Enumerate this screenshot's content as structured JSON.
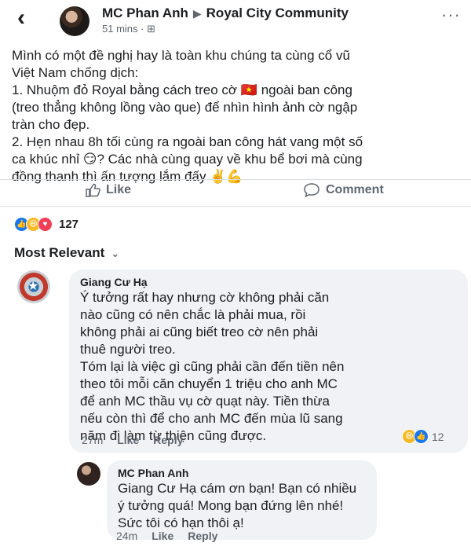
{
  "header": {
    "back_icon": "chevron-left-icon",
    "author": "MC Phan Anh",
    "separator": "▶",
    "group": "Royal City Community",
    "time": "51 mins",
    "privacy_icon": "group-icon",
    "more": "···"
  },
  "post": {
    "lines": [
      "Mình có một đề nghị hay là toàn khu chúng ta cùng cổ vũ",
      "Việt Nam chống dịch:",
      "1. Nhuộm đỏ Royal bằng cách treo cờ 🇻🇳 ngoài ban công",
      "(treo thẳng không lồng vào que) để nhìn hình ảnh cờ ngập",
      "tràn cho đẹp.",
      "2. Hẹn nhau 8h tối cùng ra ngoài ban công hát vang một số",
      "ca khúc nhỉ 😏? Các nhà cùng quay về khu bể bơi mà cùng",
      "đồng thanh thì ấn tượng lắm đấy ✌️💪"
    ]
  },
  "actions": {
    "like": "Like",
    "comment": "Comment"
  },
  "reactions": {
    "count": "127",
    "colors": {
      "like": "#1877f2",
      "haha": "#f7b928",
      "love": "#f33e58"
    }
  },
  "sort": {
    "label": "Most Relevant"
  },
  "comments": [
    {
      "author": "Giang Cư Hạ",
      "lines": [
        "Ý tưởng rất hay nhưng cờ không phải căn",
        "nào cũng có nên chắc là phải mua, rồi",
        "không phải ai cũng biết treo cờ nên phải",
        "thuê người treo.",
        "Tóm lại là việc gì cũng phải cần đến tiền nên",
        "theo tôi mỗi căn chuyển 1 triệu cho anh MC",
        "để anh MC thầu vụ cờ quạt này. Tiền thừa",
        "nếu còn thì để cho anh MC đến mùa lũ sang",
        "năm đi làm từ thiện cũng được."
      ],
      "time": "27m",
      "like": "Like",
      "reply": "Reply",
      "reaction_count": "12"
    },
    {
      "author": "MC Phan Anh",
      "lines": [
        "Giang Cư Hạ cám ơn bạn! Bạn có nhiều",
        "ý tưởng quá! Mong bạn đứng lên nhé!",
        "Sức tôi có hạn thôi ạ!"
      ],
      "time": "24m",
      "like": "Like",
      "reply": "Reply"
    }
  ]
}
